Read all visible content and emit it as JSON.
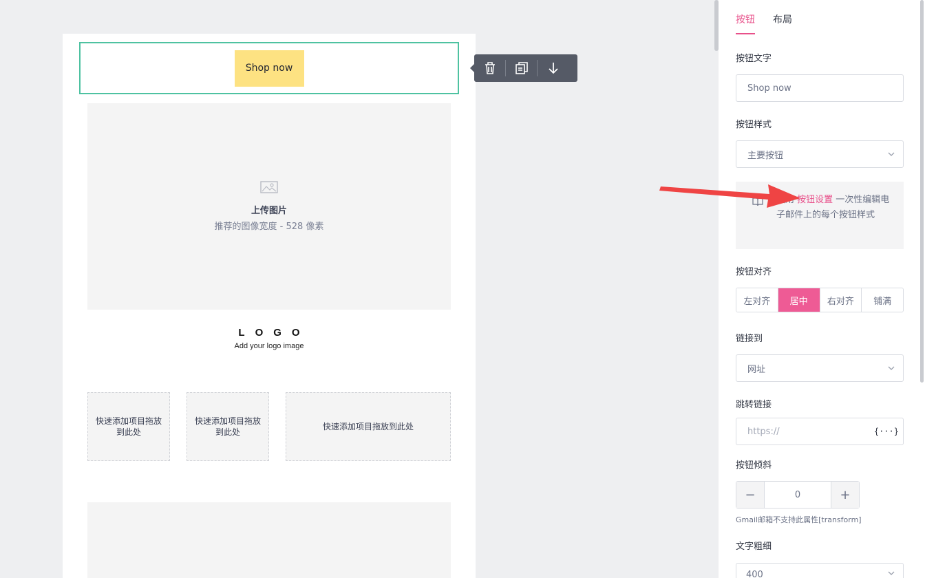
{
  "canvas": {
    "button_text": "Shop now",
    "image_placeholder": {
      "title": "上传图片",
      "subtitle": "推荐的图像宽度 - 528 像素"
    },
    "logo": {
      "mark": "LOGO",
      "sub": "Add your logo image"
    },
    "drop_zones": [
      "快速添加项目拖放到此处",
      "快速添加项目拖放到此处",
      "快速添加项目拖放到此处"
    ]
  },
  "toolbar": {
    "icons": [
      "trash-icon",
      "duplicate-icon",
      "arrow-down-icon"
    ]
  },
  "panel": {
    "tabs": [
      "按钮",
      "布局"
    ],
    "active_tab": "按钮",
    "button_text_label": "按钮文字",
    "button_text_value": "Shop now",
    "button_style_label": "按钮样式",
    "button_style_value": "主要按钮",
    "hint": {
      "prefix": "使用",
      "link": "按钮设置",
      "suffix": " 一次性编辑电子邮件上的每个按钮样式"
    },
    "align_label": "按钮对齐",
    "align_options": [
      "左对齐",
      "居中",
      "右对齐",
      "铺满"
    ],
    "align_active": "居中",
    "link_to_label": "链接到",
    "link_to_value": "网址",
    "redirect_label": "跳转链接",
    "redirect_placeholder": "https://",
    "var_symbol": "{···}",
    "skew_label": "按钮倾斜",
    "skew_value": "0",
    "skew_note": "Gmail邮箱不支持此属性[transform]",
    "weight_label": "文字粗细",
    "weight_value": "400"
  },
  "colors": {
    "accent": "#e8508a",
    "selection_border": "#4ec2a1",
    "button_fill": "#fde282",
    "annotation_arrow": "#ef4444"
  }
}
